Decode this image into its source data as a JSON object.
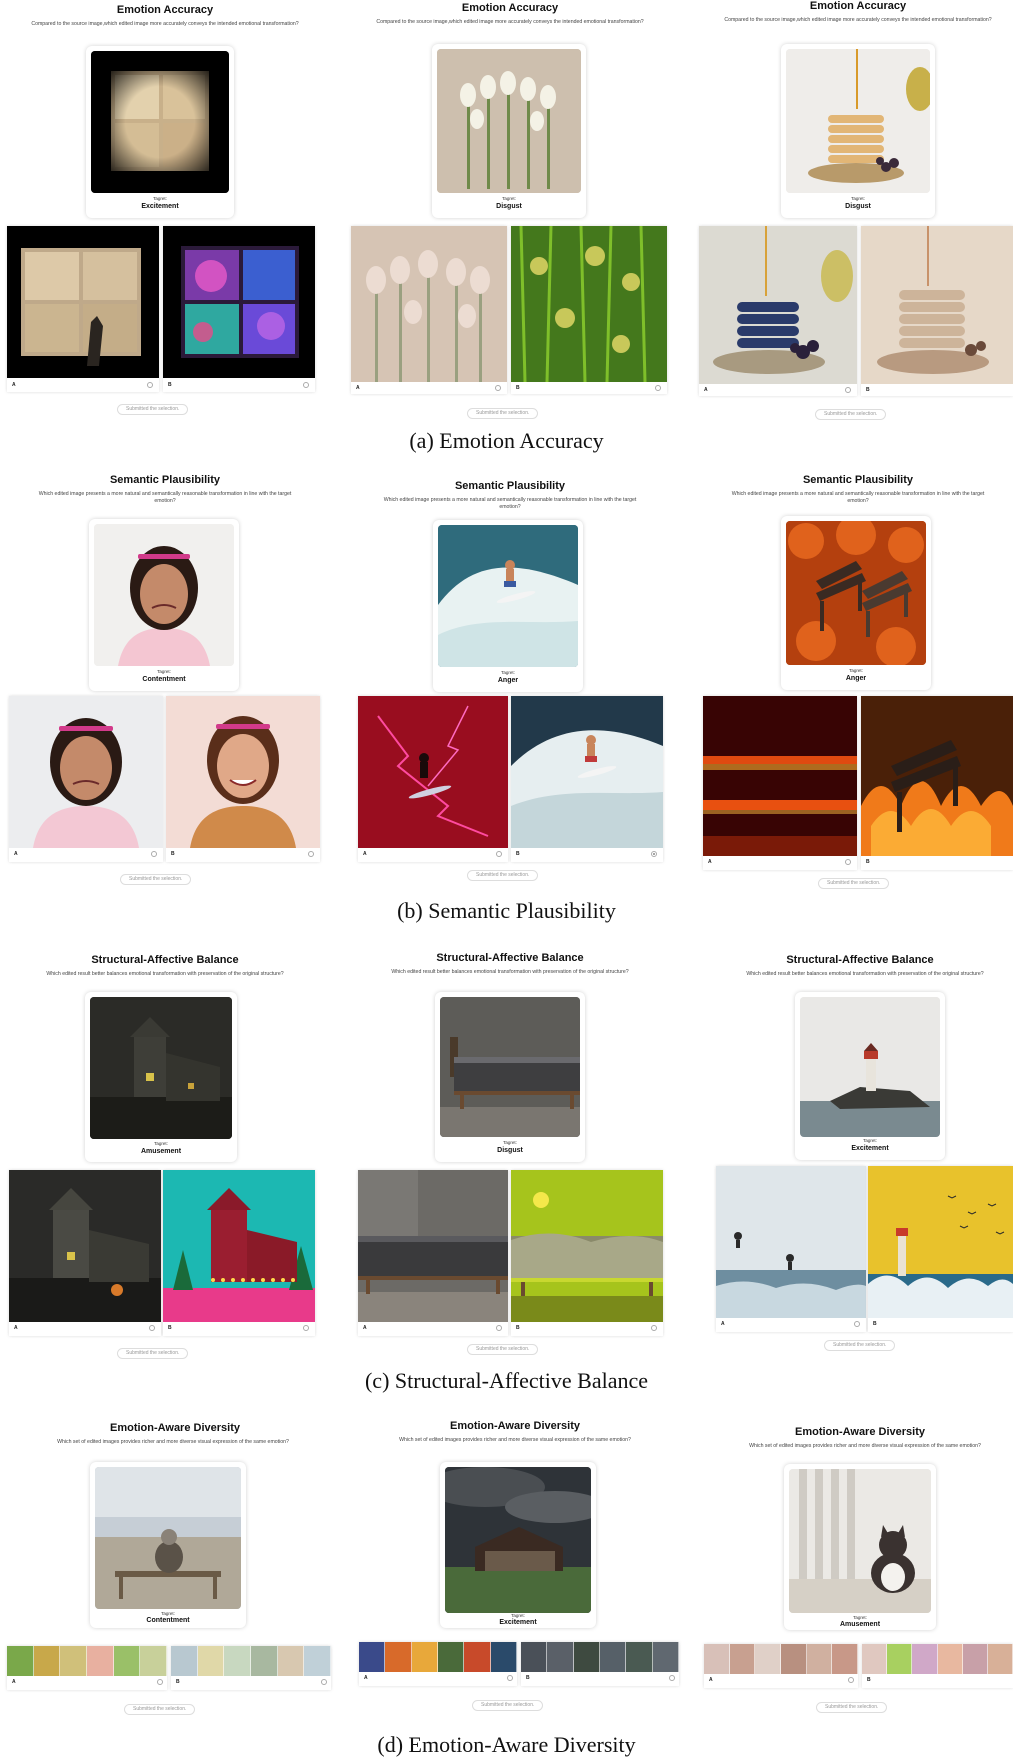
{
  "sections": [
    {
      "caption": "(a) Emotion Accuracy",
      "panels": [
        {
          "title": "Emotion Accuracy",
          "question": "Compared to the source image,which edited image more accurately conveys the intended emotional transformation?",
          "target_label": "Tagret:",
          "target": "Excitement",
          "option_a": "A",
          "option_b": "B",
          "submit": "Submitted the selection."
        },
        {
          "title": "Emotion Accuracy",
          "question": "Compared to the source image,which edited image more accurately conveys the intended emotional transformation?",
          "target_label": "Tagret:",
          "target": "Disgust",
          "option_a": "A",
          "option_b": "B",
          "submit": "Submitted the selection."
        },
        {
          "title": "Emotion Accuracy",
          "question": "Compared to the source image,which edited image more accurately conveys the intended emotional transformation?",
          "target_label": "Tagret:",
          "target": "Disgust",
          "option_a": "A",
          "option_b": "B",
          "submit": "Submitted the selection."
        }
      ]
    },
    {
      "caption": "(b) Semantic Plausibility",
      "panels": [
        {
          "title": "Semantic Plausibility",
          "question": "Which edited image presents a more natural and semantically reasonable transformation in line with the target emotion?",
          "target_label": "Tagret:",
          "target": "Contentment",
          "option_a": "A",
          "option_b": "B",
          "submit": "Submitted the selection."
        },
        {
          "title": "Semantic Plausibility",
          "question": "Which edited image presents a more natural and semantically reasonable transformation in line with the target emotion?",
          "target_label": "Tagret:",
          "target": "Anger",
          "option_a": "A",
          "option_b": "B",
          "submit": "Submitted the selection."
        },
        {
          "title": "Semantic Plausibility",
          "question": "Which edited image presents a more natural and semantically reasonable transformation in line with the target emotion?",
          "target_label": "Tagret:",
          "target": "Anger",
          "option_a": "A",
          "option_b": "B",
          "submit": "Submitted the selection."
        }
      ]
    },
    {
      "caption": "(c) Structural-Affective Balance",
      "panels": [
        {
          "title": "Structural-Affective Balance",
          "question": "Which edited result better balances emotional transformation with preservation of the original structure?",
          "target_label": "Tagret:",
          "target": "Amusement",
          "option_a": "A",
          "option_b": "B",
          "submit": "Submitted the selection."
        },
        {
          "title": "Structural-Affective Balance",
          "question": "Which edited result better balances emotional transformation with preservation of the original structure?",
          "target_label": "Tagret:",
          "target": "Disgust",
          "option_a": "A",
          "option_b": "B",
          "submit": "Submitted the selection."
        },
        {
          "title": "Structural-Affective Balance",
          "question": "Which edited result better balances emotional transformation with preservation of the original structure?",
          "target_label": "Tagret:",
          "target": "Excitement",
          "option_a": "A",
          "option_b": "B",
          "submit": "Submitted the selection."
        }
      ]
    },
    {
      "caption": "(d) Emotion-Aware Diversity",
      "panels": [
        {
          "title": "Emotion-Aware Diversity",
          "question": "Which set of edited images provides richer and more diverse visual expression of the same emotion?",
          "target_label": "Tagret:",
          "target": "Contentment",
          "option_a": "A",
          "option_b": "B",
          "submit": "Submitted the selection."
        },
        {
          "title": "Emotion-Aware Diversity",
          "question": "Which set of edited images provides richer and more diverse visual expression of the same emotion?",
          "target_label": "Tagret:",
          "target": "Excitement",
          "option_a": "A",
          "option_b": "B",
          "submit": "Submitted the selection."
        },
        {
          "title": "Emotion-Aware Diversity",
          "question": "Which set of edited images provides richer and more diverse visual expression of the same emotion?",
          "target_label": "Tagret:",
          "target": "Amusement",
          "option_a": "A",
          "option_b": "B",
          "submit": "Submitted the selection."
        }
      ]
    }
  ],
  "colors": {
    "caption": "#111111",
    "card_shadow": "#cccccc",
    "submit_text": "#999999"
  }
}
